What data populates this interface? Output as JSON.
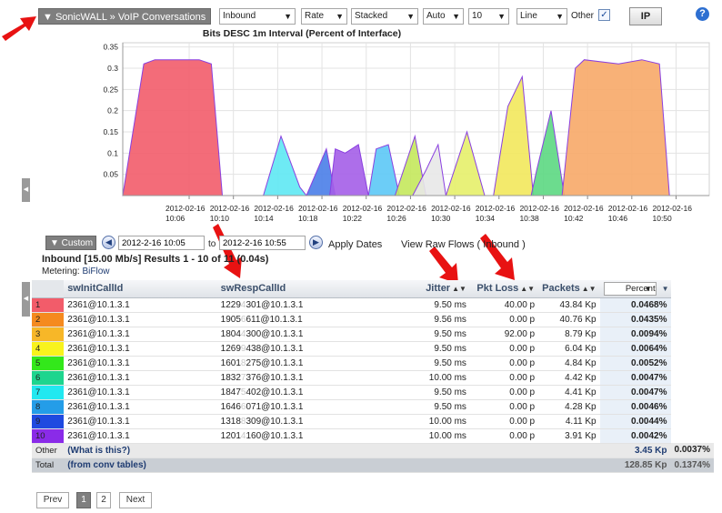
{
  "toolbar": {
    "title": "▼ SonicWALL » VoIP Conversations",
    "direction": "Inbound",
    "unit": "Rate",
    "style": "Stacked",
    "scale": "Auto",
    "count": "10",
    "chart_type": "Line",
    "other_label": "Other",
    "other_checked": true,
    "ip_label": "IP",
    "help": "?"
  },
  "chart_data": {
    "type": "area",
    "title": "Bits DESC  1m Interval (Percent of Interface)",
    "ylim": [
      0,
      0.36
    ],
    "yticks": [
      "0.35",
      "0.3",
      "0.25",
      "0.2",
      "0.15",
      "0.1",
      "0.05"
    ],
    "xticks": [
      {
        "date": "2012-02-16",
        "time": "10:06"
      },
      {
        "date": "2012-02-16",
        "time": "10:10"
      },
      {
        "date": "2012-02-16",
        "time": "10:14"
      },
      {
        "date": "2012-02-16",
        "time": "10:18"
      },
      {
        "date": "2012-02-16",
        "time": "10:22"
      },
      {
        "date": "2012-02-16",
        "time": "10:26"
      },
      {
        "date": "2012-02-16",
        "time": "10:30"
      },
      {
        "date": "2012-02-16",
        "time": "10:34"
      },
      {
        "date": "2012-02-16",
        "time": "10:38"
      },
      {
        "date": "2012-02-16",
        "time": "10:42"
      },
      {
        "date": "2012-02-16",
        "time": "10:46"
      },
      {
        "date": "2012-02-16",
        "time": "10:50"
      }
    ],
    "x_minutes_range": [
      10.0,
      63.0
    ],
    "series": [
      {
        "color": "#f25c6a",
        "points": [
          [
            10.0,
            0
          ],
          [
            11.9,
            0.31
          ],
          [
            12.9,
            0.32
          ],
          [
            16.9,
            0.32
          ],
          [
            18.0,
            0.31
          ],
          [
            19.0,
            0
          ]
        ]
      },
      {
        "color": "#5ee8f3",
        "points": [
          [
            22.7,
            0
          ],
          [
            24.3,
            0.14
          ],
          [
            26.0,
            0.02
          ],
          [
            26.6,
            0
          ]
        ]
      },
      {
        "color": "#4a7ee8",
        "points": [
          [
            26.6,
            0
          ],
          [
            28.4,
            0.11
          ],
          [
            29.2,
            0
          ]
        ]
      },
      {
        "color": "#a45ee8",
        "points": [
          [
            28.7,
            0
          ],
          [
            29.2,
            0.11
          ],
          [
            30.1,
            0.1
          ],
          [
            31.3,
            0.12
          ],
          [
            32.2,
            0
          ]
        ]
      },
      {
        "color": "#5cc8f6",
        "points": [
          [
            32.2,
            0
          ],
          [
            32.9,
            0.11
          ],
          [
            34.0,
            0.12
          ],
          [
            35.0,
            0
          ]
        ]
      },
      {
        "color": "#c4e85c",
        "points": [
          [
            34.6,
            0
          ],
          [
            36.4,
            0.14
          ],
          [
            37.4,
            0
          ]
        ]
      },
      {
        "color": "#e8e8e8",
        "points": [
          [
            36.2,
            0
          ],
          [
            37.4,
            0.06
          ],
          [
            38.5,
            0.12
          ],
          [
            39.2,
            0
          ]
        ]
      },
      {
        "color": "#e6f06a",
        "points": [
          [
            39.2,
            0
          ],
          [
            41.1,
            0.15
          ],
          [
            42.7,
            0
          ]
        ]
      },
      {
        "color": "#f2e85c",
        "points": [
          [
            43.5,
            0
          ],
          [
            44.8,
            0.21
          ],
          [
            46.1,
            0.28
          ],
          [
            47.1,
            0
          ]
        ]
      },
      {
        "color": "#5cd882",
        "points": [
          [
            46.9,
            0
          ],
          [
            47.4,
            0.06
          ],
          [
            48.7,
            0.2
          ],
          [
            49.9,
            0
          ]
        ]
      },
      {
        "color": "#f7a868",
        "points": [
          [
            49.7,
            0
          ],
          [
            50.9,
            0.3
          ],
          [
            51.7,
            0.32
          ],
          [
            54.8,
            0.31
          ],
          [
            56.9,
            0.32
          ],
          [
            58.5,
            0.31
          ],
          [
            59.4,
            0
          ]
        ]
      }
    ]
  },
  "date_range": {
    "custom_label": "▼ Custom",
    "prev_icon": "◀",
    "from": "2012-2-16 10:05",
    "to_label": "to",
    "to": "2012-2-16 10:55",
    "next_icon": "▶",
    "apply_label": "Apply Dates",
    "raw_flows_label": "View Raw Flows ( Inbound )"
  },
  "summary": {
    "headline": "Inbound [15.00 Mb/s] Results 1 - 10 of 11 (0.04s)",
    "metering_label": "Metering:",
    "metering_value": "BiFlow"
  },
  "table": {
    "columns": [
      "swInitCallId",
      "swRespCallId",
      "Jitter",
      "Pkt Loss",
      "Packets",
      "Percent"
    ],
    "rows": [
      {
        "rank": "1",
        "color": "#f25c6a",
        "init": "2361@10.1.3.1",
        "resp_a": "1229",
        "resp_blur": "4",
        "resp_b": "301@10.1.3.1",
        "jitter": "9.50 ms",
        "loss": "40.00 p",
        "packets": "43.84 Kp",
        "percent": "0.0468%"
      },
      {
        "rank": "2",
        "color": "#f58a1f",
        "init": "2361@10.1.3.1",
        "resp_a": "1905",
        "resp_blur": "6",
        "resp_b": "611@10.1.3.1",
        "jitter": "9.56 ms",
        "loss": "0.00 p",
        "packets": "40.76 Kp",
        "percent": "0.0435%"
      },
      {
        "rank": "3",
        "color": "#f7b728",
        "init": "2361@10.1.3.1",
        "resp_a": "1804",
        "resp_blur": "4",
        "resp_b": "300@10.1.3.1",
        "jitter": "9.50 ms",
        "loss": "92.00 p",
        "packets": "8.79 Kp",
        "percent": "0.0094%"
      },
      {
        "rank": "4",
        "color": "#f8f31d",
        "init": "2361@10.1.3.1",
        "resp_a": "1269",
        "resp_blur": "9",
        "resp_b": "438@10.1.3.1",
        "jitter": "9.50 ms",
        "loss": "0.00 p",
        "packets": "6.04 Kp",
        "percent": "0.0064%"
      },
      {
        "rank": "5",
        "color": "#33e81b",
        "init": "2361@10.1.3.1",
        "resp_a": "1601",
        "resp_blur": "8",
        "resp_b": "275@10.1.3.1",
        "jitter": "9.50 ms",
        "loss": "0.00 p",
        "packets": "4.84 Kp",
        "percent": "0.0052%"
      },
      {
        "rank": "6",
        "color": "#1ed58e",
        "init": "2361@10.1.3.1",
        "resp_a": "1832",
        "resp_blur": "7",
        "resp_b": "376@10.1.3.1",
        "jitter": "10.00 ms",
        "loss": "0.00 p",
        "packets": "4.42 Kp",
        "percent": "0.0047%"
      },
      {
        "rank": "7",
        "color": "#22e8f0",
        "init": "2361@10.1.3.1",
        "resp_a": "1847",
        "resp_blur": "5",
        "resp_b": "402@10.1.3.1",
        "jitter": "9.50 ms",
        "loss": "0.00 p",
        "packets": "4.41 Kp",
        "percent": "0.0047%"
      },
      {
        "rank": "8",
        "color": "#249de8",
        "init": "2361@10.1.3.1",
        "resp_a": "1646",
        "resp_blur": "6",
        "resp_b": "071@10.1.3.1",
        "jitter": "9.50 ms",
        "loss": "0.00 p",
        "packets": "4.28 Kp",
        "percent": "0.0046%"
      },
      {
        "rank": "9",
        "color": "#1f4ae0",
        "init": "2361@10.1.3.1",
        "resp_a": "1318",
        "resp_blur": "8",
        "resp_b": "309@10.1.3.1",
        "jitter": "10.00 ms",
        "loss": "0.00 p",
        "packets": "4.11 Kp",
        "percent": "0.0044%"
      },
      {
        "rank": "10",
        "color": "#8a2be8",
        "init": "2361@10.1.3.1",
        "resp_a": "1201",
        "resp_blur": "4",
        "resp_b": "160@10.1.3.1",
        "jitter": "10.00 ms",
        "loss": "0.00 p",
        "packets": "3.91 Kp",
        "percent": "0.0042%"
      }
    ],
    "other": {
      "rank": "Other",
      "label": "(What is this?)",
      "packets": "3.45 Kp",
      "percent": "0.0037%"
    },
    "total": {
      "rank": "Total",
      "label": "(from conv tables)",
      "packets": "128.85 Kp",
      "percent": "0.1374%"
    }
  },
  "pagination": {
    "prev": "Prev",
    "pages": [
      "1",
      "2"
    ],
    "next": "Next"
  }
}
